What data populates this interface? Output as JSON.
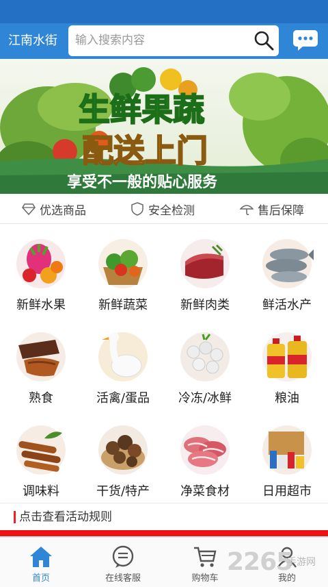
{
  "header": {
    "city": "江南水街",
    "search_placeholder": "输入搜索内容"
  },
  "banner": {
    "title_line1": "生鲜果蔬",
    "title_line2": "配送上门",
    "subtitle": "享受不一般的贴心服务"
  },
  "features": [
    {
      "label": "优选商品",
      "icon": "diamond-icon"
    },
    {
      "label": "安全检测",
      "icon": "shield-icon"
    },
    {
      "label": "售后保障",
      "icon": "umbrella-icon"
    }
  ],
  "categories": [
    {
      "label": "新鲜水果",
      "icon": "fruit-icon"
    },
    {
      "label": "新鲜蔬菜",
      "icon": "vegetable-icon"
    },
    {
      "label": "新鲜肉类",
      "icon": "meat-icon"
    },
    {
      "label": "鲜活水产",
      "icon": "fish-icon"
    },
    {
      "label": "熟食",
      "icon": "cooked-food-icon"
    },
    {
      "label": "活禽/蛋品",
      "icon": "goose-icon"
    },
    {
      "label": "冷冻/冰鲜",
      "icon": "frozen-food-icon"
    },
    {
      "label": "粮油",
      "icon": "oil-bottle-icon"
    },
    {
      "label": "调味料",
      "icon": "cinnamon-icon"
    },
    {
      "label": "干货/特产",
      "icon": "mushroom-icon"
    },
    {
      "label": "净菜食材",
      "icon": "sliced-meat-icon"
    },
    {
      "label": "日用超市",
      "icon": "grocery-icon"
    }
  ],
  "promo": {
    "rules_text": "点击查看活动规则"
  },
  "tabs": [
    {
      "label": "首页",
      "icon": "home-icon",
      "active": true
    },
    {
      "label": "在线客服",
      "icon": "chat-icon",
      "active": false
    },
    {
      "label": "购物车",
      "icon": "cart-icon",
      "active": false
    },
    {
      "label": "我的",
      "icon": "user-icon",
      "active": false
    }
  ],
  "watermark": {
    "number": "2265",
    "suffix": "手游网"
  },
  "colors": {
    "brand_blue": "#2f86d7",
    "status_blue": "#2470c4",
    "promo_red": "#ee1111"
  }
}
